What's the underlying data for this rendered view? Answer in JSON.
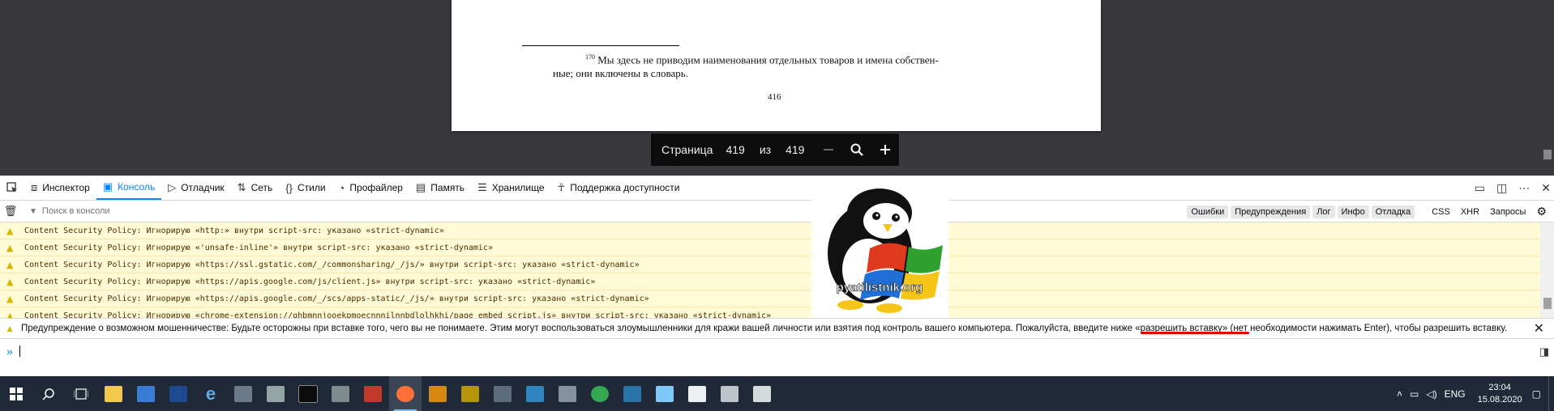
{
  "pdf": {
    "footnote_number": "170",
    "footnote_line1": "Мы здесь не приводим наименования отдельных товаров и имена собствен-",
    "footnote_line2": "ные; они включены в словарь.",
    "printed_page_number": "416",
    "toolbar": {
      "page_label": "Страница",
      "current_page": "419",
      "of_label": "из",
      "total_pages": "419",
      "zoom_out": "—",
      "zoom_icon": "⌕",
      "zoom_in": "+"
    }
  },
  "devtools": {
    "tabs": [
      {
        "label": "Инспектор",
        "icon": "inspector-icon"
      },
      {
        "label": "Консоль",
        "icon": "console-icon",
        "active": true
      },
      {
        "label": "Отладчик",
        "icon": "debugger-icon"
      },
      {
        "label": "Сеть",
        "icon": "network-icon"
      },
      {
        "label": "Стили",
        "icon": "style-editor-icon"
      },
      {
        "label": "Профайлер",
        "icon": "profiler-icon"
      },
      {
        "label": "Память",
        "icon": "memory-icon"
      },
      {
        "label": "Хранилище",
        "icon": "storage-icon"
      },
      {
        "label": "Поддержка доступности",
        "icon": "accessibility-icon"
      }
    ],
    "filter_placeholder": "Поиск в консоли",
    "filter_buttons": {
      "errors": "Ошибки",
      "warnings": "Предупреждения",
      "logs": "Лог",
      "info": "Инфо",
      "debug": "Отладка",
      "css": "CSS",
      "xhr": "XHR",
      "requests": "Запросы"
    },
    "messages": [
      "Content Security Policy: Игнорирую «http:» внутри script-src: указано «strict-dynamic»",
      "Content Security Policy: Игнорирую «'unsafe-inline'» внутри script-src: указано «strict-dynamic»",
      "Content Security Policy: Игнорирую «https://ssl.gstatic.com/_/commonsharing/_/js/» внутри script-src: указано «strict-dynamic»",
      "Content Security Policy: Игнорирую «https://apis.google.com/js/client.js» внутри script-src: указано «strict-dynamic»",
      "Content Security Policy: Игнорирую «https://apis.google.com/_/scs/apps-static/_/js/» внутри script-src: указано «strict-dynamic»",
      "Content Security Policy: Игнорирую «chrome-extension://ghbmnnjooekpmoecnnnilnnbdlolhkhi/page_embed_script.js» внутри script-src: указано «strict-dynamic»"
    ],
    "paste_warning": "Предупреждение о возможном мошенничестве: Будьте осторожны при вставке того, чего вы не понимаете. Этим могут воспользоваться злоумышленники для кражи вашей личности или взятия под контроль вашего компьютера. Пожалуйста, введите ниже «разрешить вставку» (нет необходимости нажимать Enter), чтобы разрешить вставку.",
    "prompt_symbol": "»"
  },
  "logo": {
    "text": "pyatilistnik.org"
  },
  "taskbar": {
    "language": "ENG",
    "time": "23:04",
    "date": "15.08.2020",
    "icon_colors": [
      "#f2c94c",
      "#3a7bd5",
      "#5dade2",
      "#e74c3c",
      "#2c3e50",
      "#1abc9c",
      "#e67e22",
      "#ff7139",
      "#16a085",
      "#f1c40f",
      "#3498db",
      "#2980b9",
      "#95a5a6",
      "#34a853",
      "#5dade2",
      "#7fc8f8",
      "#ecf0f1",
      "#bdc3c7",
      "#d5dbdb"
    ]
  }
}
